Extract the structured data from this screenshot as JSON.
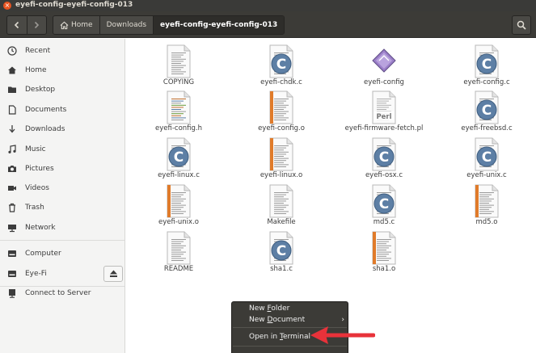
{
  "window": {
    "title": "eyefi-config-eyefi-config-013"
  },
  "header": {
    "breadcrumbs": [
      {
        "label": "Home",
        "icon": "home-icon"
      },
      {
        "label": "Downloads"
      },
      {
        "label": "eyefi-config-eyefi-config-013"
      }
    ]
  },
  "sidebar": {
    "places": [
      "Recent",
      "Home",
      "Desktop",
      "Documents",
      "Downloads",
      "Music",
      "Pictures",
      "Videos",
      "Trash",
      "Network"
    ],
    "devices": [
      "Computer",
      "Eye-Fi"
    ],
    "other": [
      "Connect to Server"
    ]
  },
  "files": [
    {
      "name": "COPYING",
      "kind": "text"
    },
    {
      "name": "eyefi-chdk.c",
      "kind": "c"
    },
    {
      "name": "eyefi-config",
      "kind": "exec"
    },
    {
      "name": "eyefi-config.c",
      "kind": "c"
    },
    {
      "name": "eyefi-config.h",
      "kind": "header"
    },
    {
      "name": "eyefi-config.o",
      "kind": "object"
    },
    {
      "name": "eyefi-firmware-fetch.pl",
      "kind": "perl"
    },
    {
      "name": "eyefi-freebsd.c",
      "kind": "c"
    },
    {
      "name": "eyefi-linux.c",
      "kind": "c"
    },
    {
      "name": "eyefi-linux.o",
      "kind": "object"
    },
    {
      "name": "eyefi-osx.c",
      "kind": "c"
    },
    {
      "name": "eyefi-unix.c",
      "kind": "c"
    },
    {
      "name": "eyefi-unix.o",
      "kind": "object"
    },
    {
      "name": "Makefile",
      "kind": "text"
    },
    {
      "name": "md5.c",
      "kind": "c"
    },
    {
      "name": "md5.o",
      "kind": "object"
    },
    {
      "name": "README",
      "kind": "text"
    },
    {
      "name": "sha1.c",
      "kind": "c"
    },
    {
      "name": "sha1.o",
      "kind": "object"
    }
  ],
  "context_menu": {
    "new_folder": {
      "pre": "New ",
      "key": "F",
      "post": "older"
    },
    "new_document": {
      "pre": "New ",
      "key": "D",
      "post": "ocument"
    },
    "open_terminal": {
      "pre": "Open in ",
      "key": "T",
      "post": "erminal"
    }
  },
  "colors": {
    "accent": "#e95420",
    "c_source": "#5d7fa5",
    "object_stripe": "#e07b2a",
    "annotation_arrow": "#e8323a"
  }
}
